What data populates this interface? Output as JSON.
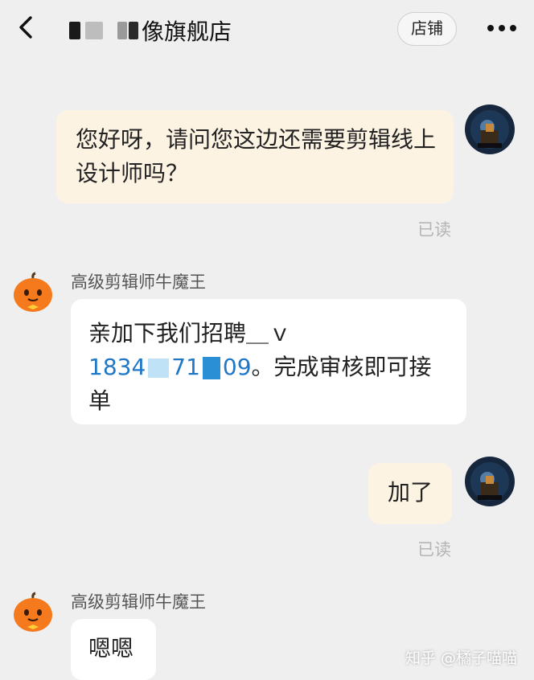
{
  "header": {
    "title_suffix": "像旗舰店",
    "shop_button": "店铺"
  },
  "messages": [
    {
      "text": "您好呀，请问您这边还需要剪辑线上设计师吗？",
      "read_status": "已读"
    },
    {
      "sender": "高级剪辑师牛魔王",
      "text_before_phone": "亲加下我们招聘＿ｖ",
      "phone_start": "1834",
      "phone_mid": "71",
      "phone_end": "09",
      "text_after_phone": "。完成审核即可接单"
    },
    {
      "text": "加了",
      "read_status": "已读"
    },
    {
      "sender": "高级剪辑师牛魔王",
      "text": "嗯嗯"
    }
  ],
  "watermark": "知乎 @橘子喵喵",
  "colors": {
    "background": "#efefef",
    "my_bubble": "#fdf3e3",
    "their_bubble": "#ffffff",
    "link": "#1f77c8"
  },
  "icons": {
    "back": "chevron-left-icon",
    "more": "more-dots-icon",
    "seller_avatar": "pumpkin-mascot-icon"
  }
}
